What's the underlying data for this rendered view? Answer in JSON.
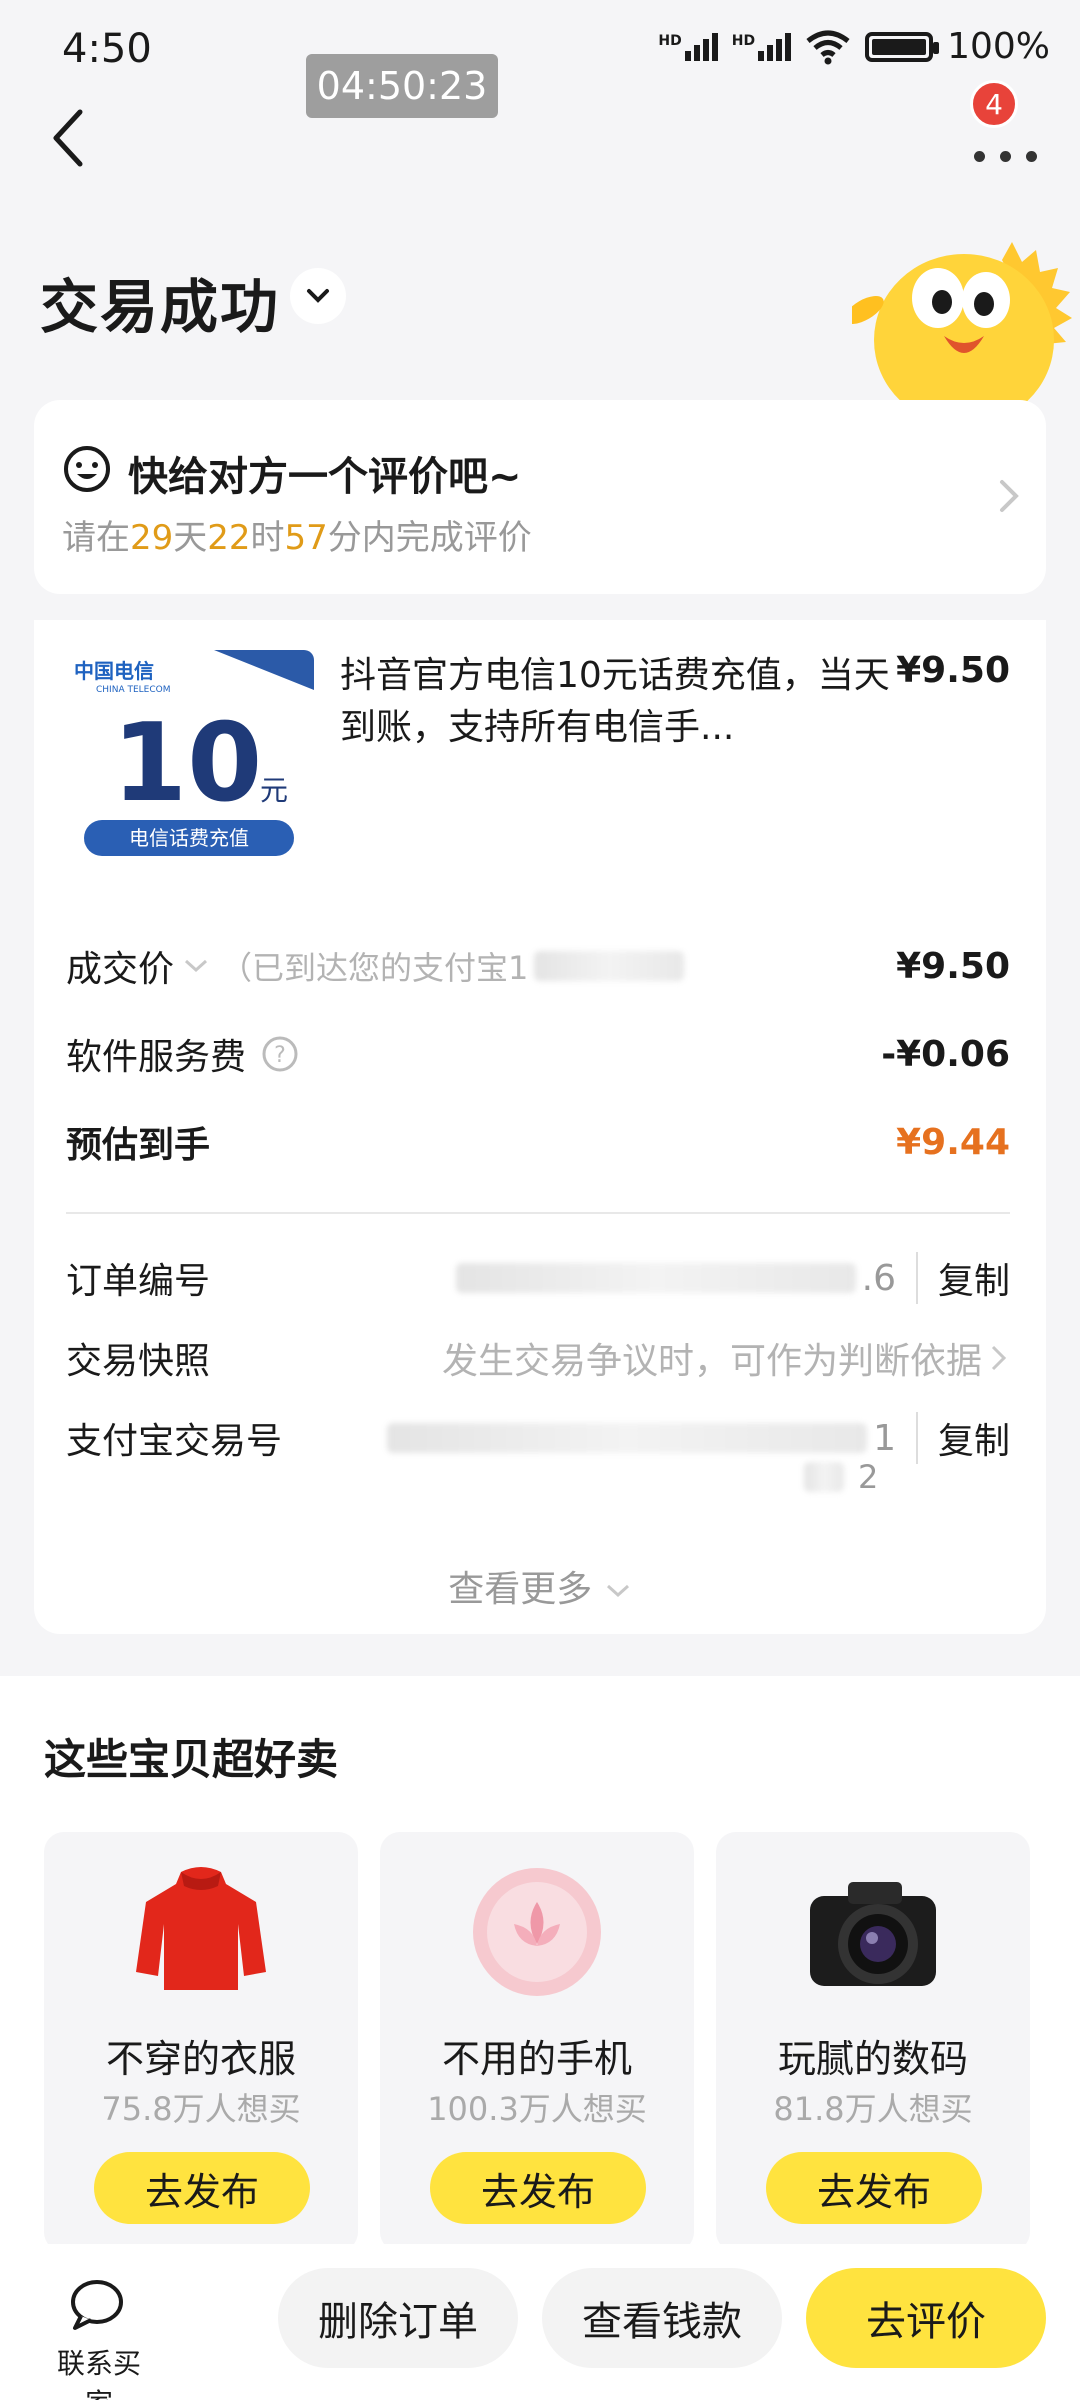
{
  "status_bar": {
    "time": "4:50",
    "clock_overlay": "04:50:23",
    "battery": "100%",
    "network_1": "HD",
    "network_2": "HD"
  },
  "nav": {
    "notification_count": "4"
  },
  "header": {
    "title": "交易成功"
  },
  "review_prompt": {
    "title": "快给对方一个评价吧~",
    "sub_prefix": "请在",
    "days": "29",
    "days_unit": "天",
    "hours": "22",
    "hours_unit": "时",
    "minutes": "57",
    "minutes_unit": "分内完成评价"
  },
  "product": {
    "title": "抖音官方电信10元话费充值，当天到账，支持所有电信手...",
    "price": "¥9.50",
    "image_brand": "中国电信",
    "image_brand_en": "CHINA TELECOM",
    "image_amount": "10",
    "image_unit": "元",
    "image_caption": "电信话费充值"
  },
  "pricing": {
    "deal_label": "成交价",
    "deal_note": "（已到达您的支付宝1",
    "deal_value": "¥9.50",
    "fee_label": "软件服务费",
    "fee_value": "-¥0.06",
    "estimate_label": "预估到手",
    "estimate_value": "¥9.44"
  },
  "details": {
    "order_no_label": "订单编号",
    "order_no_tail": ".6",
    "copy": "复制",
    "snapshot_label": "交易快照",
    "snapshot_value": "发生交易争议时，可作为判断依据",
    "alipay_label": "支付宝交易号",
    "alipay_tail": "1",
    "alipay_tail2": "2",
    "copy2": "复制",
    "see_more": "查看更多"
  },
  "recommendations": {
    "title": "这些宝贝超好卖",
    "items": [
      {
        "name": "不穿的衣服",
        "count": "75.8万人想买",
        "button": "去发布"
      },
      {
        "name": "不用的手机",
        "count": "100.3万人想买",
        "button": "去发布"
      },
      {
        "name": "玩腻的数码",
        "count": "81.8万人想买",
        "button": "去发布"
      }
    ]
  },
  "bottom_bar": {
    "contact": "联系买家",
    "delete": "删除订单",
    "view_money": "查看钱款",
    "review": "去评价"
  },
  "colors": {
    "accent_yellow": "#ffe33f",
    "orange": "#e6711f",
    "highlight": "#e09b18"
  }
}
